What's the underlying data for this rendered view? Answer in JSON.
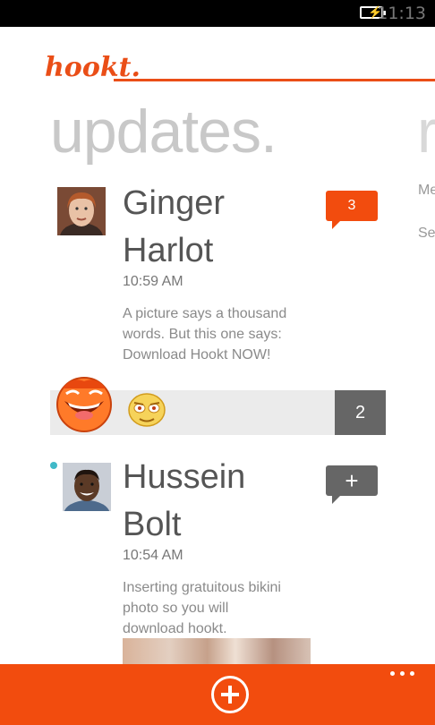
{
  "status_bar": {
    "time": "11:13",
    "battery_icon": "battery-charging-icon"
  },
  "app": {
    "logo": "hookt.",
    "accent": "#f24c0e"
  },
  "panorama": {
    "title": "updates.",
    "next_title_peek": "r",
    "peek_lines": [
      "Me",
      "Se"
    ]
  },
  "feed": [
    {
      "name_line1": "Ginger",
      "name_line2": "Harlot",
      "time": "10:59 AM",
      "message_lines": [
        "A picture says a thousand",
        "words. But this one says:",
        "Download Hookt NOW!"
      ],
      "comment_count": "3"
    },
    {
      "name_line1": "Hussein",
      "name_line2": "Bolt",
      "time": "10:54 AM",
      "message_lines": [
        "Inserting gratuitous bikini",
        "photo so you will",
        "download hookt."
      ],
      "comment_action": "+"
    }
  ],
  "reactions": {
    "count": "2",
    "icons": [
      "laughing-face-emoji-icon",
      "squinting-face-emoji-icon"
    ]
  },
  "colors": {
    "unread_dot": "#40b9c8",
    "bubble_gray": "#666666"
  }
}
